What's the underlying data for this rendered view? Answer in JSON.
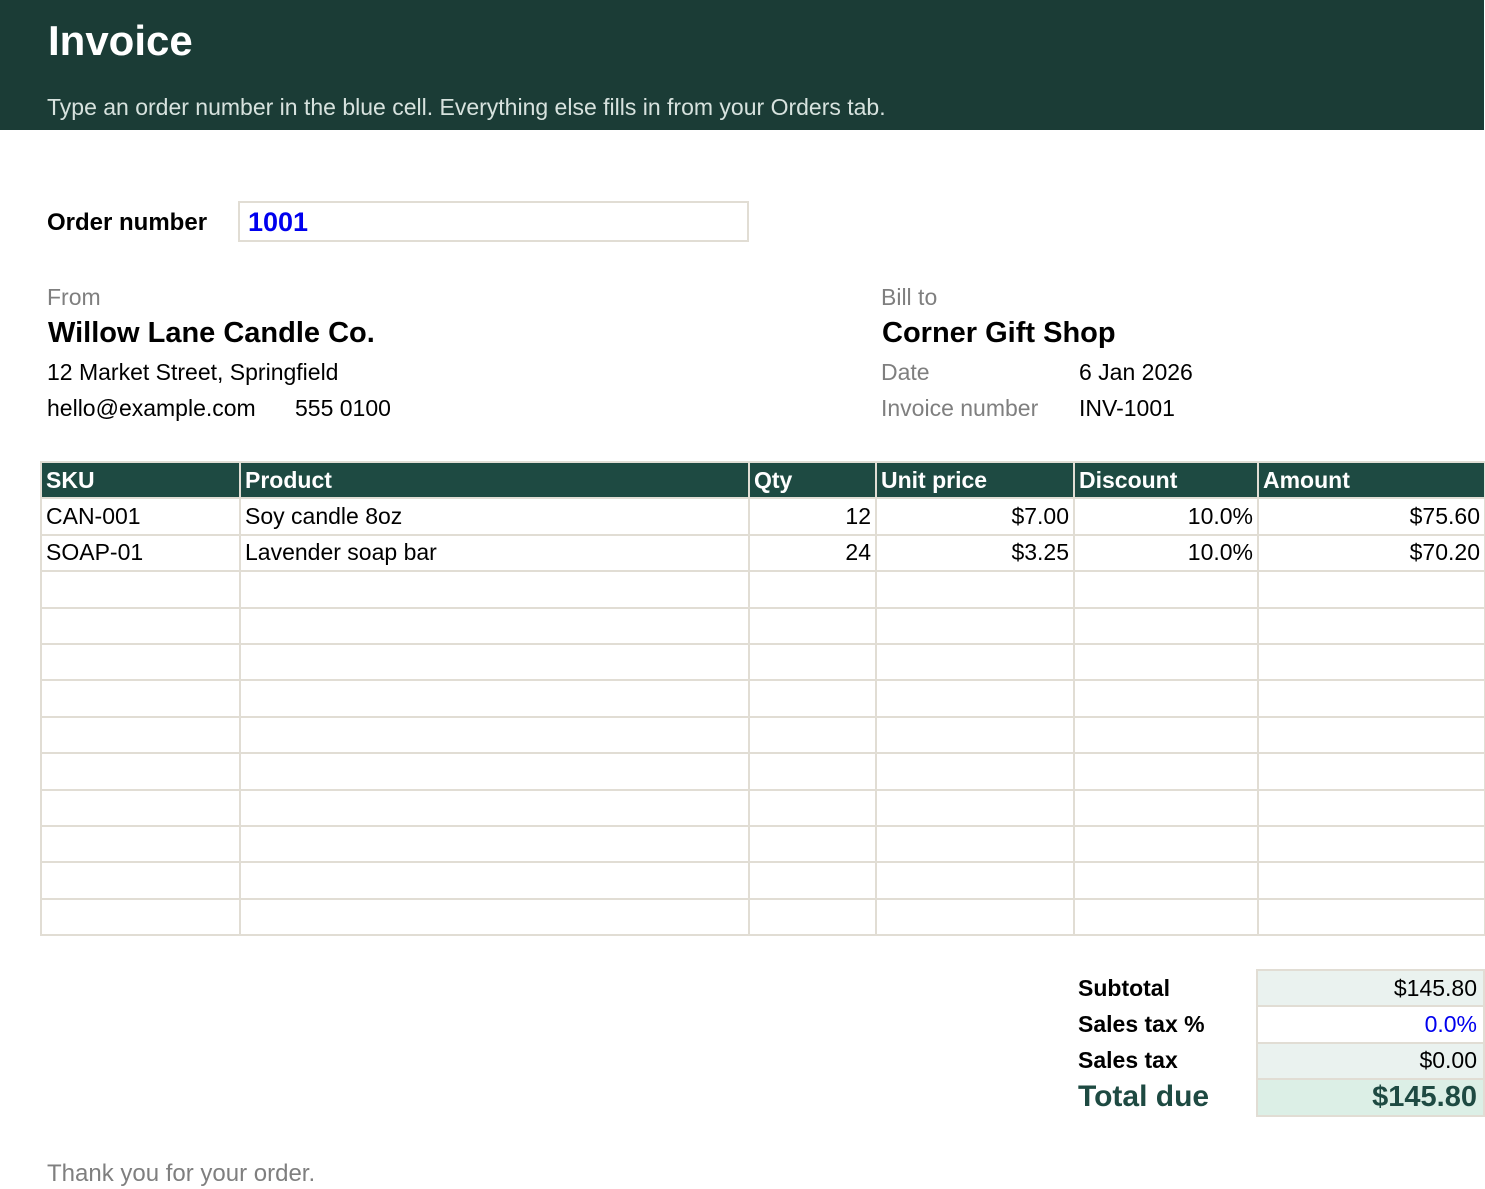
{
  "header": {
    "title": "Invoice",
    "subtitle": "Type an order number in the blue cell. Everything else fills in from your Orders tab."
  },
  "order": {
    "label": "Order number",
    "value": "1001"
  },
  "from": {
    "label": "From",
    "name": "Willow Lane Candle Co.",
    "address": "12 Market Street, Springfield",
    "email": "hello@example.com",
    "phone": "555 0100"
  },
  "bill_to": {
    "label": "Bill to",
    "name": "Corner Gift Shop",
    "date_label": "Date",
    "date_value": "6 Jan 2026",
    "invoice_label": "Invoice number",
    "invoice_value": "INV-1001"
  },
  "items": {
    "columns": [
      "SKU",
      "Product",
      "Qty",
      "Unit price",
      "Discount",
      "Amount"
    ],
    "rows": [
      [
        "CAN-001",
        "Soy candle 8oz",
        "12",
        "$7.00",
        "10.0%",
        "$75.60"
      ],
      [
        "SOAP-01",
        "Lavender soap bar",
        "24",
        "$3.25",
        "10.0%",
        "$70.20"
      ],
      [
        "",
        "",
        "",
        "",
        "",
        ""
      ],
      [
        "",
        "",
        "",
        "",
        "",
        ""
      ],
      [
        "",
        "",
        "",
        "",
        "",
        ""
      ],
      [
        "",
        "",
        "",
        "",
        "",
        ""
      ],
      [
        "",
        "",
        "",
        "",
        "",
        ""
      ],
      [
        "",
        "",
        "",
        "",
        "",
        ""
      ],
      [
        "",
        "",
        "",
        "",
        "",
        ""
      ],
      [
        "",
        "",
        "",
        "",
        "",
        ""
      ],
      [
        "",
        "",
        "",
        "",
        "",
        ""
      ],
      [
        "",
        "",
        "",
        "",
        "",
        ""
      ]
    ]
  },
  "totals": {
    "subtotal_label": "Subtotal",
    "subtotal_value": "$145.80",
    "tax_rate_label": "Sales tax %",
    "tax_rate_value": "0.0%",
    "tax_label": "Sales tax",
    "tax_value": "$0.00",
    "total_label": "Total due",
    "total_value": "$145.80"
  },
  "footer": {
    "note": "Thank you for your order."
  },
  "colors": {
    "header_bg": "#1b3c36",
    "table_header_bg": "#1e4a42",
    "input_text": "#0000ee",
    "total_bg": "#dcefe6"
  }
}
